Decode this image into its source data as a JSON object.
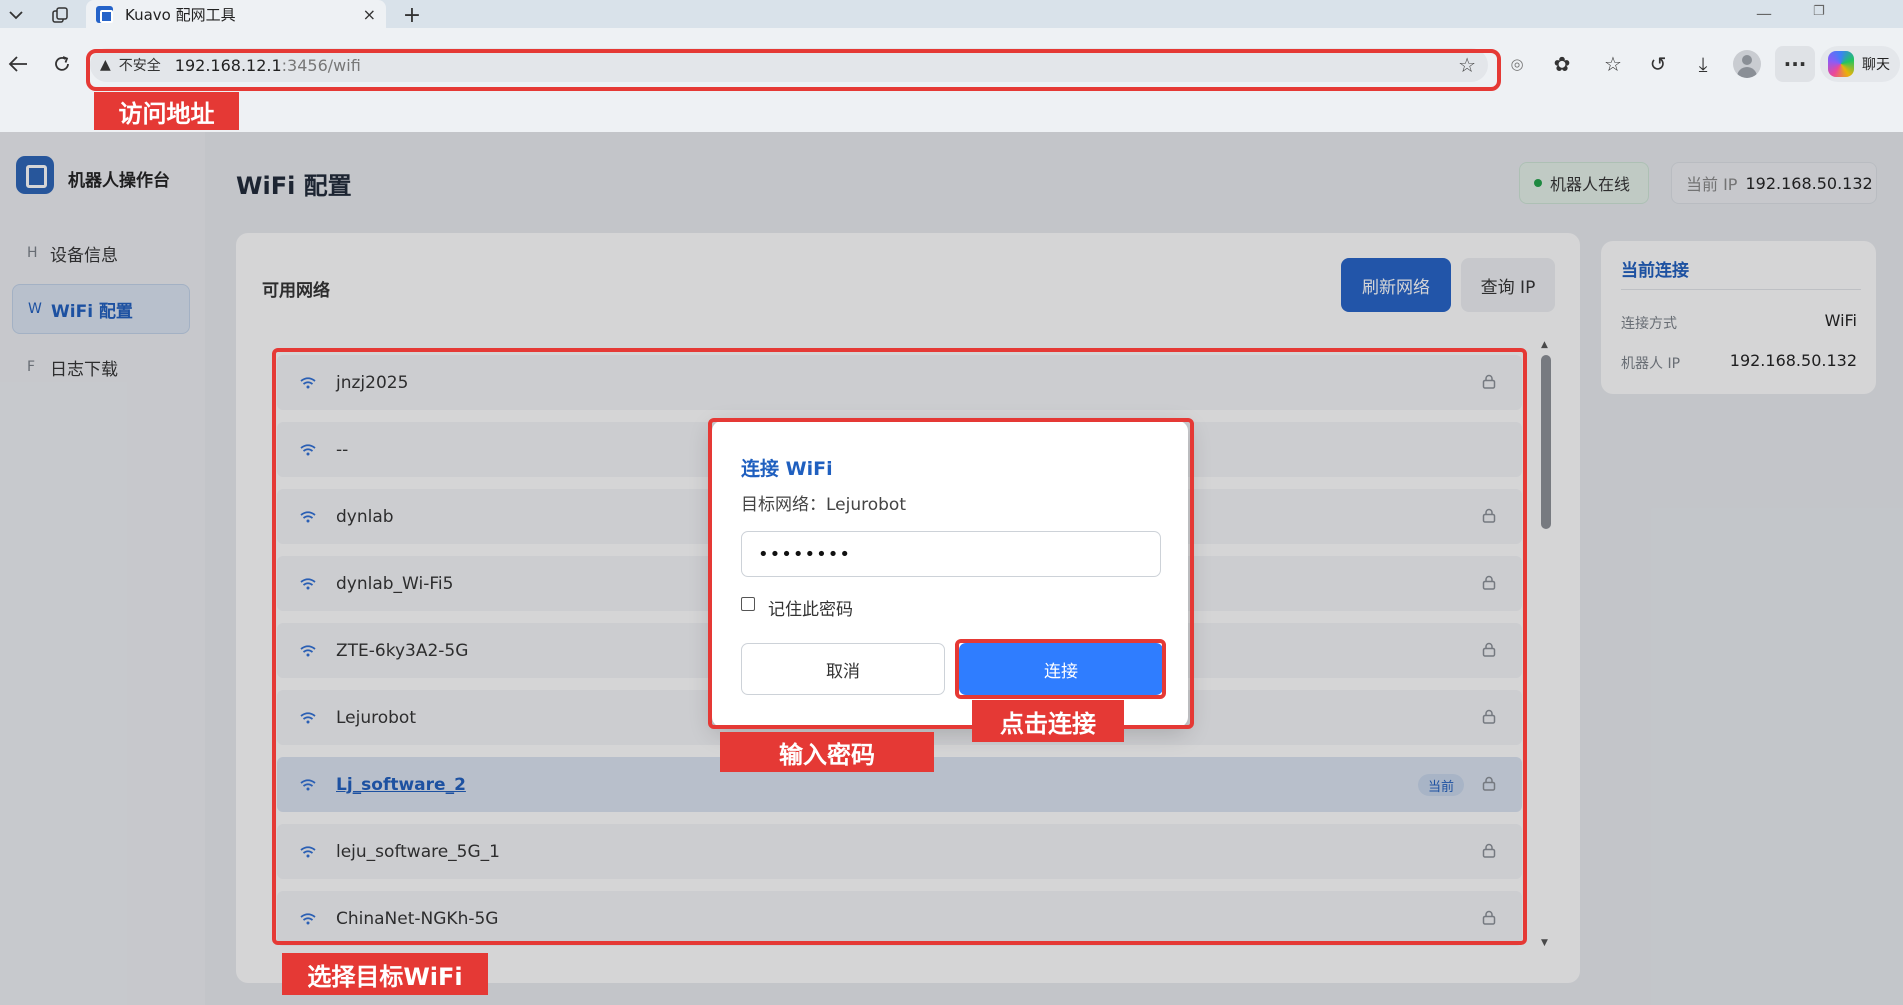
{
  "browser": {
    "tab_title": "Kuavo 配网工具",
    "tab_close": "×",
    "new_tab": "+",
    "security_label": "不安全",
    "url_host": "192.168.12.1",
    "url_path": ":3456/wifi",
    "copilot_label": "聊天"
  },
  "sidebar": {
    "brand": "机器人操作台",
    "items": [
      {
        "key": "H",
        "label": "设备信息"
      },
      {
        "key": "W",
        "label": "WiFi 配置"
      },
      {
        "key": "F",
        "label": "日志下载"
      }
    ]
  },
  "header": {
    "title": "WiFi 配置",
    "status": "机器人在线",
    "ip_label": "当前 IP",
    "ip_value": "192.168.50.132"
  },
  "networks": {
    "heading": "可用网络",
    "refresh_label": "刷新网络",
    "query_label": "查询 IP",
    "current_tag": "当前",
    "items": [
      {
        "name": "jnzj2025",
        "locked": true,
        "current": false
      },
      {
        "name": "--",
        "locked": false,
        "current": false
      },
      {
        "name": "dynlab",
        "locked": true,
        "current": false
      },
      {
        "name": "dynlab_Wi-Fi5",
        "locked": true,
        "current": false
      },
      {
        "name": "ZTE-6ky3A2-5G",
        "locked": true,
        "current": false
      },
      {
        "name": "Lejurobot",
        "locked": true,
        "current": false
      },
      {
        "name": "Lj_software_2",
        "locked": true,
        "current": true
      },
      {
        "name": "leju_software_5G_1",
        "locked": true,
        "current": false
      },
      {
        "name": "ChinaNet-NGKh-5G",
        "locked": true,
        "current": false
      }
    ]
  },
  "connection": {
    "title": "当前连接",
    "method_label": "连接方式",
    "method_value": "WiFi",
    "ip_label": "机器人 IP",
    "ip_value": "192.168.50.132"
  },
  "dialog": {
    "title": "连接 WiFi",
    "subtitle": "目标网络：Lejurobot",
    "password_value": "••••••••",
    "remember_label": "记住此密码",
    "cancel_label": "取消",
    "connect_label": "连接"
  },
  "annotations": {
    "address": "访问地址",
    "select_wifi": "选择目标WiFi",
    "enter_password": "输入密码",
    "click_connect": "点击连接"
  },
  "colors": {
    "primary": "#2563c9",
    "accent": "#2f7dff",
    "online": "#22a34a",
    "annotation": "#e53935"
  }
}
